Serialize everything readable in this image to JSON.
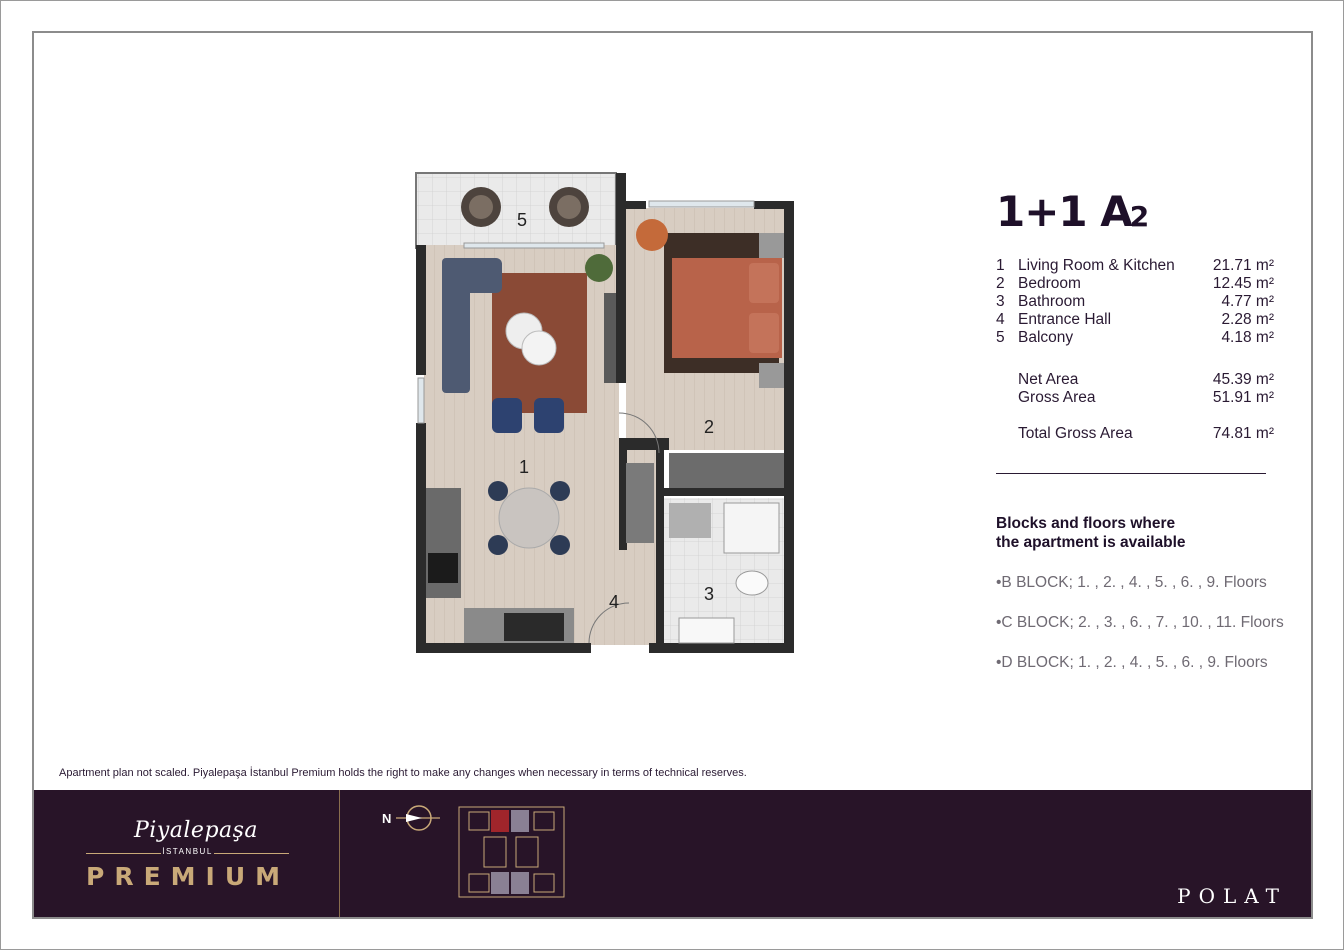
{
  "unit": {
    "title_main": "1+1 A",
    "title_sub": "2"
  },
  "rooms": [
    {
      "num": "1",
      "name": "Living Room & Kitchen",
      "area": "21.71 m²"
    },
    {
      "num": "2",
      "name": "Bedroom",
      "area": "12.45 m²"
    },
    {
      "num": "3",
      "name": "Bathroom",
      "area": "4.77 m²"
    },
    {
      "num": "4",
      "name": "Entrance Hall",
      "area": "2.28 m²"
    },
    {
      "num": "5",
      "name": "Balcony",
      "area": "4.18 m²"
    }
  ],
  "totals": {
    "net_label": "Net Area",
    "net_value": "45.39 m²",
    "gross_label": "Gross Area",
    "gross_value": "51.91 m²",
    "total_label": "Total Gross Area",
    "total_value": "74.81 m²"
  },
  "availability": {
    "heading_line1": "Blocks and floors where",
    "heading_line2": "the apartment is available",
    "blocks": [
      "•B BLOCK; 1. , 2. , 4. , 5. , 6. , 9. Floors",
      "•C BLOCK; 2. , 3. , 6. , 7. , 10. , 11. Floors",
      "•D BLOCK; 1. , 2. , 4. , 5. , 6. , 9. Floors"
    ]
  },
  "plan_labels": {
    "r1": "1",
    "r2": "2",
    "r3": "3",
    "r4": "4",
    "r5": "5"
  },
  "disclaimer": "Apartment plan not scaled. Piyalepaşa İstanbul Premium holds the right to make any changes when necessary in terms of technical reserves.",
  "footer": {
    "logo_script": "Piyalepaşa",
    "logo_city": "İSTANBUL",
    "logo_brand": "PREMIUM",
    "north_label": "N",
    "developer": "POLAT"
  },
  "colors": {
    "brand_dark": "#281428",
    "gold": "#c9a978",
    "wall": "#2b2b2b",
    "floor": "#d9cfc4"
  }
}
